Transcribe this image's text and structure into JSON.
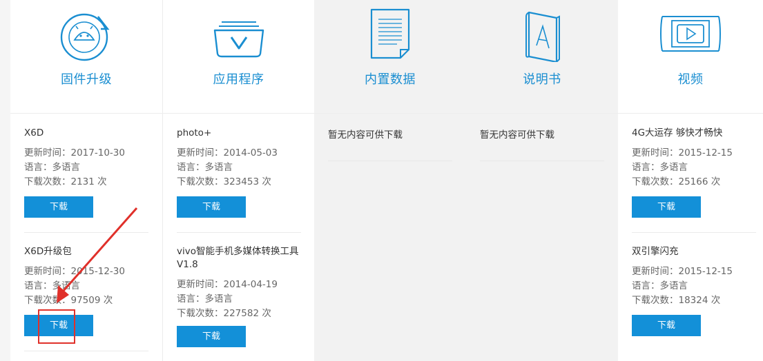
{
  "colors": {
    "accent": "#1a8ed1",
    "button": "#1390d8",
    "annotation": "#e0302a"
  },
  "columns": [
    {
      "title": "固件升级",
      "icon": "firmware-upgrade-icon",
      "items": [
        {
          "name": "X6D",
          "updated": "更新时间：2017-10-30",
          "language": "语言：多语言",
          "downloads": "下载次数：2131 次",
          "button": "下载"
        },
        {
          "name": "X6D升级包",
          "updated": "更新时间：2015-12-30",
          "language": "语言：多语言",
          "downloads": "下载次数：97509 次",
          "button": "下载"
        }
      ]
    },
    {
      "title": "应用程序",
      "icon": "app-folder-icon",
      "items": [
        {
          "name": "photo+",
          "updated": "更新时间：2014-05-03",
          "language": "语言：多语言",
          "downloads": "下载次数：323453 次",
          "button": "下载"
        },
        {
          "name": "vivo智能手机多媒体转换工具V1.8",
          "updated": "更新时间：2014-04-19",
          "language": "语言：多语言",
          "downloads": "下载次数：227582 次",
          "button": "下载"
        }
      ]
    },
    {
      "title": "内置数据",
      "icon": "document-icon",
      "empty": "暂无内容可供下载"
    },
    {
      "title": "说明书",
      "icon": "manual-book-icon",
      "empty": "暂无内容可供下载"
    },
    {
      "title": "视频",
      "icon": "video-icon",
      "items": [
        {
          "name": "4G大运存 够快才畅快",
          "updated": "更新时间：2015-12-15",
          "language": "语言：多语言",
          "downloads": "下载次数：25166 次",
          "button": "下载"
        },
        {
          "name": "双引擎闪充",
          "updated": "更新时间：2015-12-15",
          "language": "语言：多语言",
          "downloads": "下载次数：18324 次",
          "button": "下载"
        }
      ]
    }
  ]
}
